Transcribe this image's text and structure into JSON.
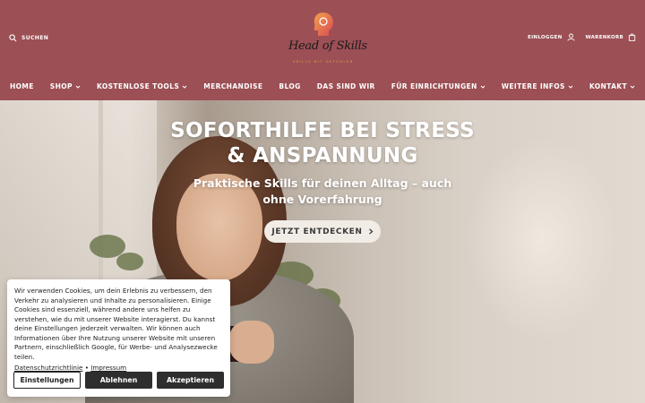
{
  "header": {
    "search_label": "SUCHEN",
    "login_label": "EINLOGGEN",
    "cart_label": "WARENKORB",
    "logo_text": "Head of Skills",
    "logo_tagline": "SKILLS MIT GEFÜHLEN"
  },
  "nav": [
    {
      "label": "HOME",
      "has_dropdown": false
    },
    {
      "label": "SHOP",
      "has_dropdown": true
    },
    {
      "label": "KOSTENLOSE TOOLS",
      "has_dropdown": true
    },
    {
      "label": "MERCHANDISE",
      "has_dropdown": false
    },
    {
      "label": "BLOG",
      "has_dropdown": false
    },
    {
      "label": "DAS SIND WIR",
      "has_dropdown": false
    },
    {
      "label": "FÜR EINRICHTUNGEN",
      "has_dropdown": true
    },
    {
      "label": "WEITERE INFOS",
      "has_dropdown": true
    },
    {
      "label": "KONTAKT",
      "has_dropdown": true
    }
  ],
  "hero": {
    "title_line1": "SOFORTHILFE BEI STRESS",
    "title_line2": "& ANSPANNUNG",
    "subtitle_line1": "Praktische Skills für deinen Alltag – auch",
    "subtitle_line2": "ohne Vorerfahrung",
    "cta_label": "JETZT ENTDECKEN"
  },
  "cookie": {
    "text": "Wir verwenden Cookies, um dein Erlebnis zu verbessern, den Verkehr zu analysieren und Inhalte zu personalisieren. Einige Cookies sind essenziell, während andere uns helfen zu verstehen, wie du mit unserer Website interagierst. Du kannst deine Einstellungen jederzeit verwalten. Wir können auch Informationen über Ihre Nutzung unserer Website mit unseren Partnern, einschließlich Google, für Werbe- und Analysezwecke teilen.",
    "privacy_link": "Datenschutzrichtlinie",
    "separator": "•",
    "imprint_link": "Impressum",
    "settings_label": "Einstellungen",
    "decline_label": "Ablehnen",
    "accept_label": "Akzeptieren"
  },
  "colors": {
    "header_bg": "#9c4f55",
    "logo_accent": "#e6a14a",
    "button_dark": "#2e2e2e"
  },
  "icons": {
    "search": "search-icon",
    "login": "user-icon",
    "cart": "shopping-bag-icon",
    "dropdown": "chevron-down-icon",
    "cta": "chevron-right-icon"
  }
}
